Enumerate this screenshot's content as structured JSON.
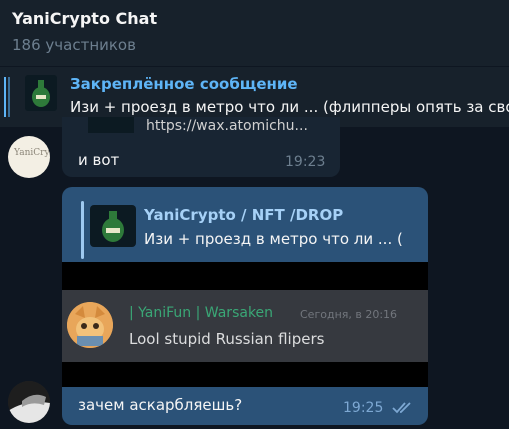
{
  "header": {
    "title": "YaniCrypto Chat",
    "subtitle": "186 участников"
  },
  "pinned": {
    "label": "Закреплённое сообщение",
    "text": "Изи + проезд в метро что ли ... (флипперы опять за свое"
  },
  "messages": [
    {
      "link_fragment": "https://wax.atomichu...",
      "text": "и вот",
      "time": "19:23",
      "avatar_icon": "yanicrypto-logo-avatar",
      "avatar_text": "YaniCrypto"
    },
    {
      "reply": {
        "name": "YaniCrypto / NFT /DROP",
        "text": "Изи + проезд в метро что ли ... ("
      },
      "image": {
        "discord_name": "| YaniFun | Warsaken",
        "discord_time": "Сегодня, в 20:16",
        "discord_text": "Lool stupid Russian flipers"
      },
      "text": "зачем аскарбляешь?",
      "time": "19:25",
      "status_icon": "double-check-icon",
      "avatar_icon": "user-avatar"
    }
  ],
  "colors": {
    "background": "#0e1621",
    "header": "#17212b",
    "incoming_bubble": "#182533",
    "outgoing_bubble": "#2b5278",
    "accent": "#5eb5f7"
  }
}
